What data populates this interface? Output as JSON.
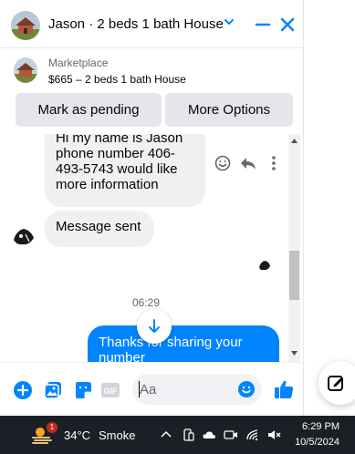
{
  "header": {
    "title": "Jason · 2 beds 1 bath House",
    "accent_color": "#0084ff"
  },
  "listing": {
    "label": "Marketplace",
    "price_title": "$665 – 2 beds 1 bath House",
    "mark_pending_label": "Mark as pending",
    "more_options_label": "More Options"
  },
  "messages": [
    {
      "sender": "other",
      "text": "Hi my name is Jason phone number 406-493-5743 would like more information"
    },
    {
      "sender": "other",
      "text": "Message sent"
    },
    {
      "sender": "me",
      "text": "Thanks for sharing your number"
    }
  ],
  "timestamp": "06:29",
  "composer": {
    "placeholder": "Aa",
    "icons": [
      "plus-icon",
      "photo-icon",
      "sticker-icon",
      "gif-icon",
      "emoji-icon",
      "thumbs-up-icon"
    ]
  },
  "taskbar": {
    "weather_badge": "1",
    "temperature": "34°C",
    "weather_desc": "Smoke",
    "time": "6:29 PM",
    "date": "10/5/2024"
  },
  "colors": {
    "outgoing_bubble": "#0084ff",
    "incoming_bubble": "#f0f0f0",
    "taskbar": "#1c1f26"
  }
}
